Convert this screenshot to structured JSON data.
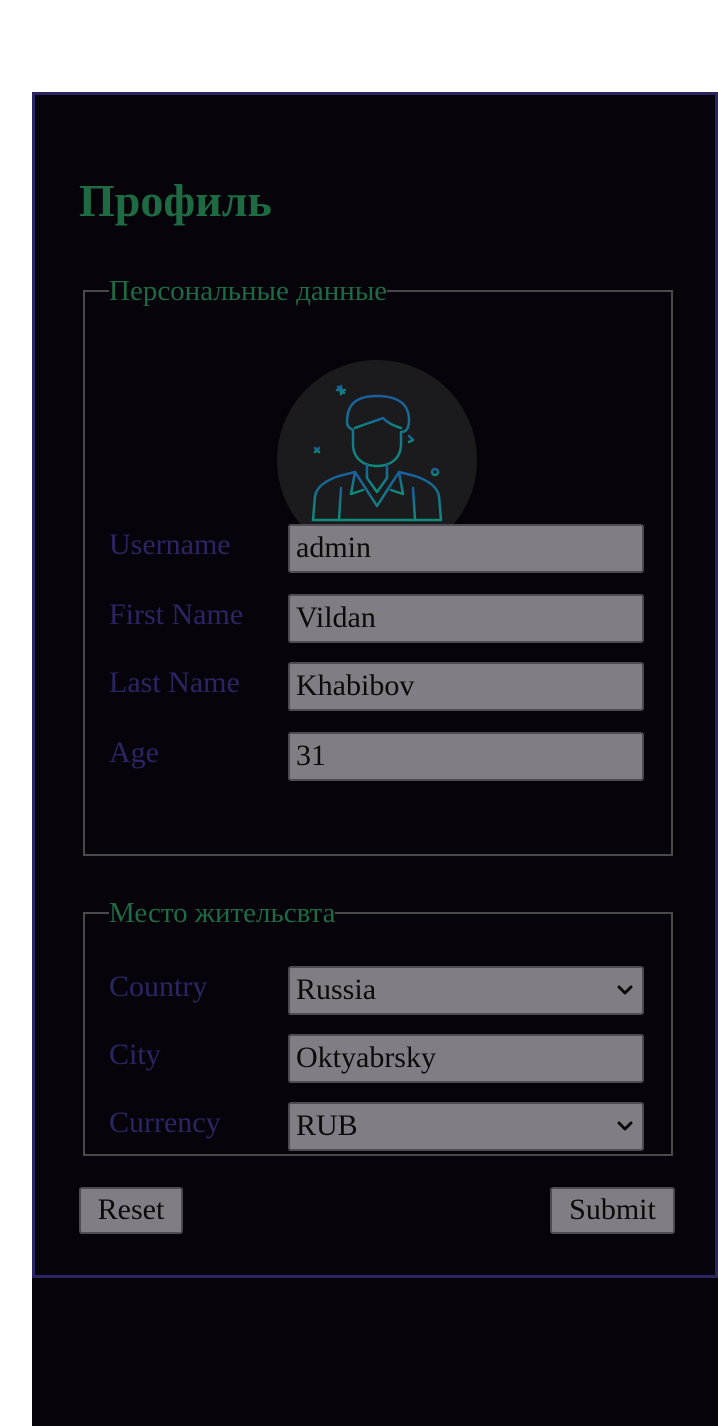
{
  "page": {
    "title": "Профиль"
  },
  "personal": {
    "legend": "Персональные данные",
    "avatar_icon": "user-avatar-icon",
    "fields": [
      {
        "label": "Username",
        "value": "admin"
      },
      {
        "label": "First Name",
        "value": "Vildan"
      },
      {
        "label": "Last Name",
        "value": "Khabibov"
      },
      {
        "label": "Age",
        "value": "31"
      }
    ]
  },
  "residence": {
    "legend": "Место жительсвта",
    "country": {
      "label": "Country",
      "value": "Russia"
    },
    "city": {
      "label": "City",
      "value": "Oktyabrsky"
    },
    "currency": {
      "label": "Currency",
      "value": "RUB"
    }
  },
  "actions": {
    "reset_label": "Reset",
    "submit_label": "Submit"
  },
  "colors": {
    "background": "#07030b",
    "accent_green": "#1e6a43",
    "label_indigo": "#2b2663",
    "field_gray": "#807e84",
    "icon_teal": "#0f8b7a",
    "icon_blue": "#1a5f9e"
  }
}
